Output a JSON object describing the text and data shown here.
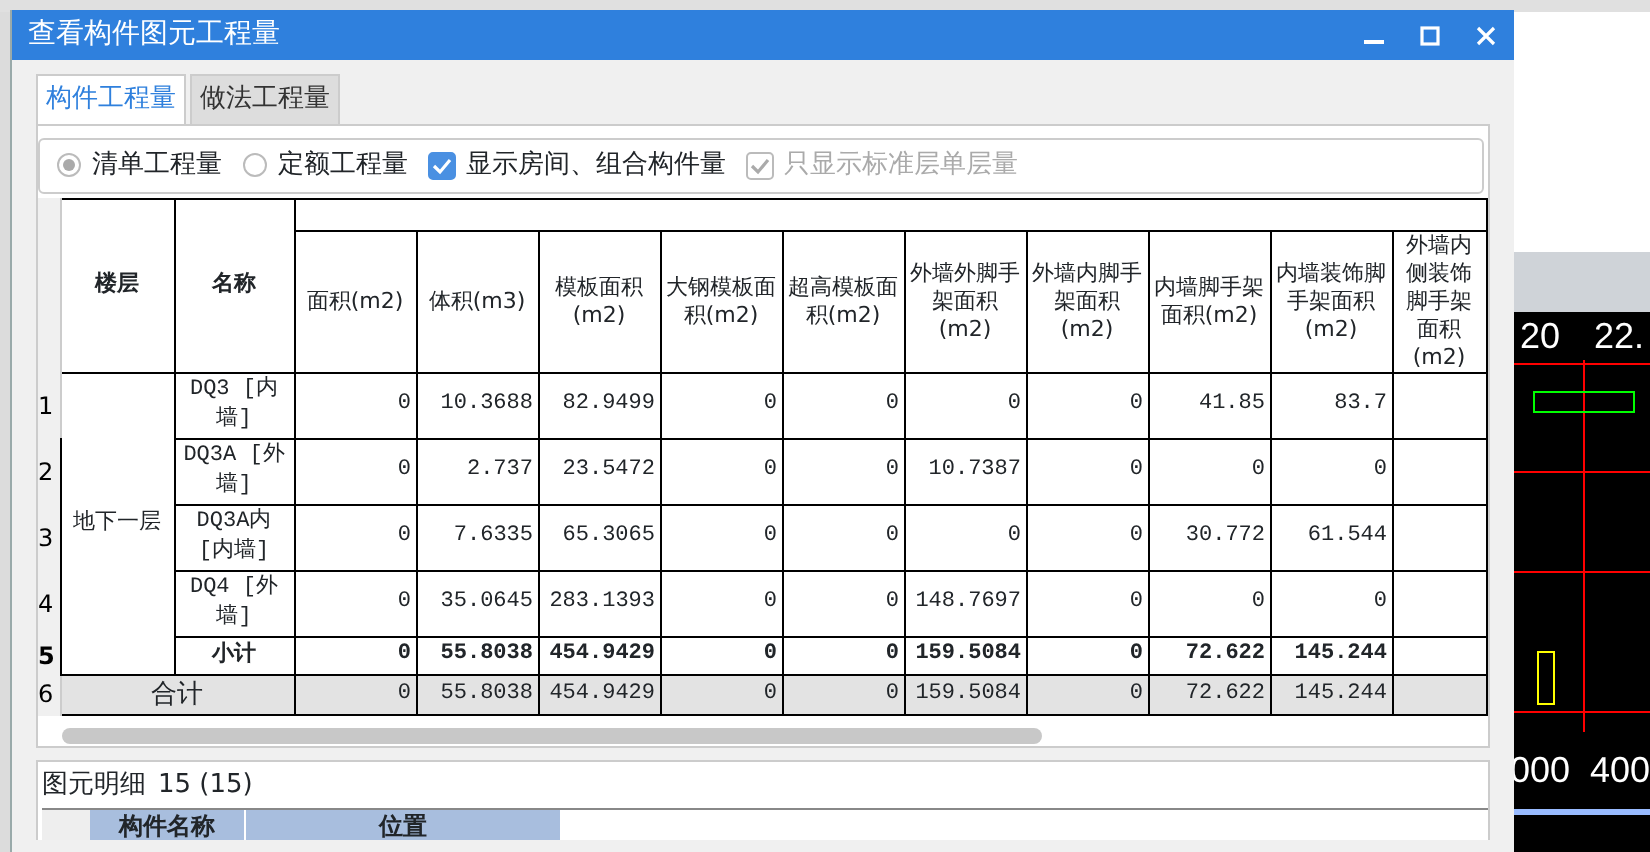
{
  "window": {
    "title": "查看构件图元工程量"
  },
  "tabs": [
    {
      "label": "构件工程量",
      "selected": true
    },
    {
      "label": "做法工程量",
      "selected": false
    }
  ],
  "options": [
    {
      "kind": "radio",
      "label": "清单工程量",
      "checked": true,
      "disabled": false
    },
    {
      "kind": "radio",
      "label": "定额工程量",
      "checked": false,
      "disabled": false
    },
    {
      "kind": "checkbox",
      "label": "显示房间、组合构件量",
      "checked": true,
      "disabled": false
    },
    {
      "kind": "checkbox",
      "label": "只显示标准层单层量",
      "checked": true,
      "disabled": true
    }
  ],
  "table": {
    "columns": [
      "楼层",
      "名称",
      "面积(m2)",
      "体积(m3)",
      "模板面积(m2)",
      "大钢模板面积(m2)",
      "超高模板面积(m2)",
      "外墙外脚手架面积(m2)",
      "外墙内脚手架面积(m2)",
      "内墙脚手架面积(m2)",
      "内墙装饰脚手架面积(m2)",
      "外墙内侧装饰脚手架面积(m2)"
    ],
    "groups": [
      {
        "floor": "地下一层",
        "rows": [
          {
            "row_number": "1",
            "name": "DQ3 [内墙]",
            "values": [
              "0",
              "10.3688",
              "82.9499",
              "0",
              "0",
              "0",
              "0",
              "41.85",
              "83.7"
            ]
          },
          {
            "row_number": "2",
            "name": "DQ3A [外墙]",
            "values": [
              "0",
              "2.737",
              "23.5472",
              "0",
              "0",
              "10.7387",
              "0",
              "0",
              "0"
            ]
          },
          {
            "row_number": "3",
            "name": "DQ3A内 [内墙]",
            "values": [
              "0",
              "7.6335",
              "65.3065",
              "0",
              "0",
              "0",
              "0",
              "30.772",
              "61.544"
            ]
          },
          {
            "row_number": "4",
            "name": "DQ4 [外墙]",
            "values": [
              "0",
              "35.0645",
              "283.1393",
              "0",
              "0",
              "148.7697",
              "0",
              "0",
              "0"
            ]
          }
        ],
        "subtotal": {
          "row_number": "5",
          "label": "小计",
          "values": [
            "0",
            "55.8038",
            "454.9429",
            "0",
            "0",
            "159.5084",
            "0",
            "72.622",
            "145.244"
          ]
        }
      }
    ],
    "total": {
      "row_number": "6",
      "label": "合计",
      "values": [
        "0",
        "55.8038",
        "454.9429",
        "0",
        "0",
        "159.5084",
        "0",
        "72.622",
        "145.244"
      ]
    }
  },
  "detail": {
    "title": "图元明细",
    "count": "15 (15)",
    "columns": [
      "构件名称",
      "位置"
    ]
  },
  "background": {
    "cad_labels": [
      "20",
      "22.",
      "000",
      "400"
    ]
  }
}
